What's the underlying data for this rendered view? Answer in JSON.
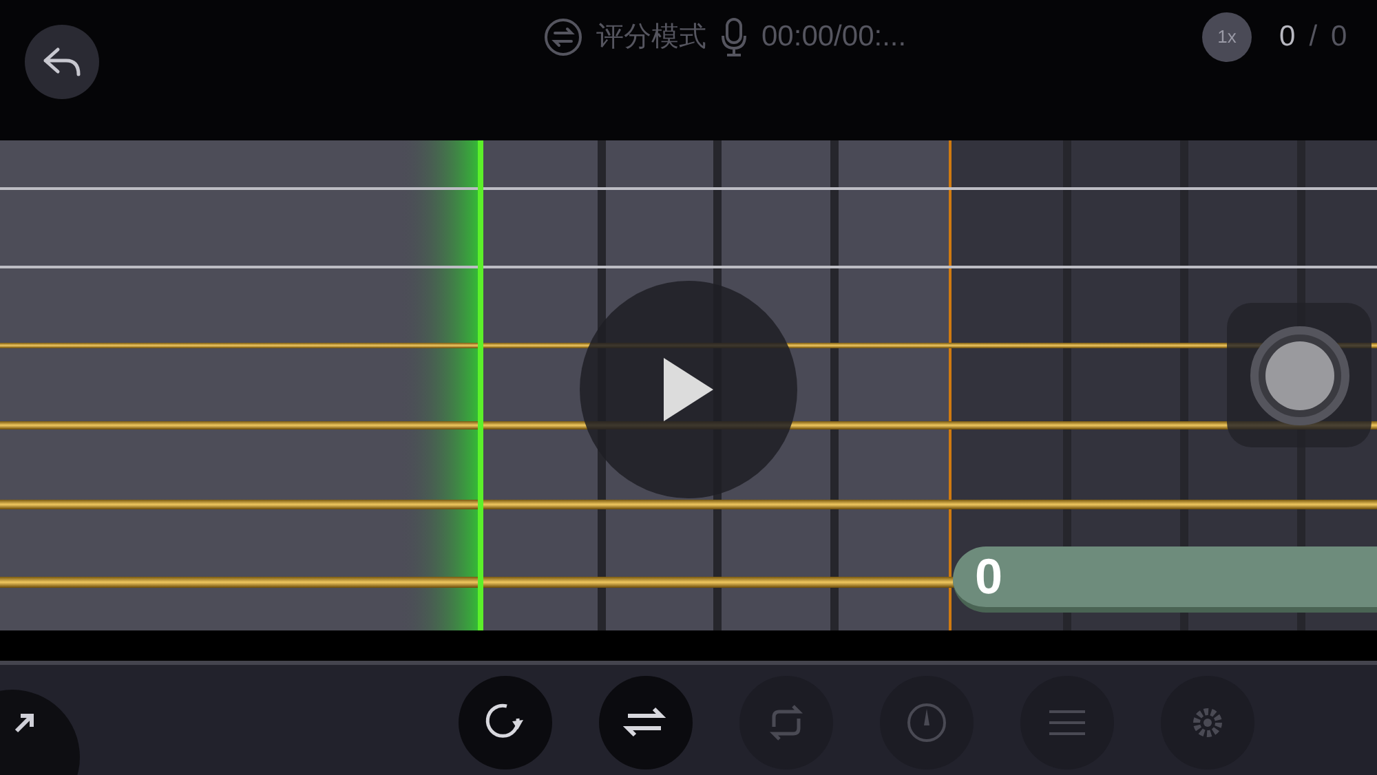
{
  "header": {
    "mode_label": "评分模式",
    "time": "00:00/00:...",
    "speed": "1x",
    "score": "0",
    "separator": "/",
    "total": "0"
  },
  "note_bar": {
    "text": "0"
  },
  "toolbar": [
    {
      "kind": "restart",
      "disabled": false
    },
    {
      "kind": "switch",
      "disabled": false
    },
    {
      "kind": "loop",
      "disabled": true
    },
    {
      "kind": "tempo",
      "disabled": true
    },
    {
      "kind": "lines",
      "disabled": true
    },
    {
      "kind": "gear",
      "disabled": true
    }
  ]
}
